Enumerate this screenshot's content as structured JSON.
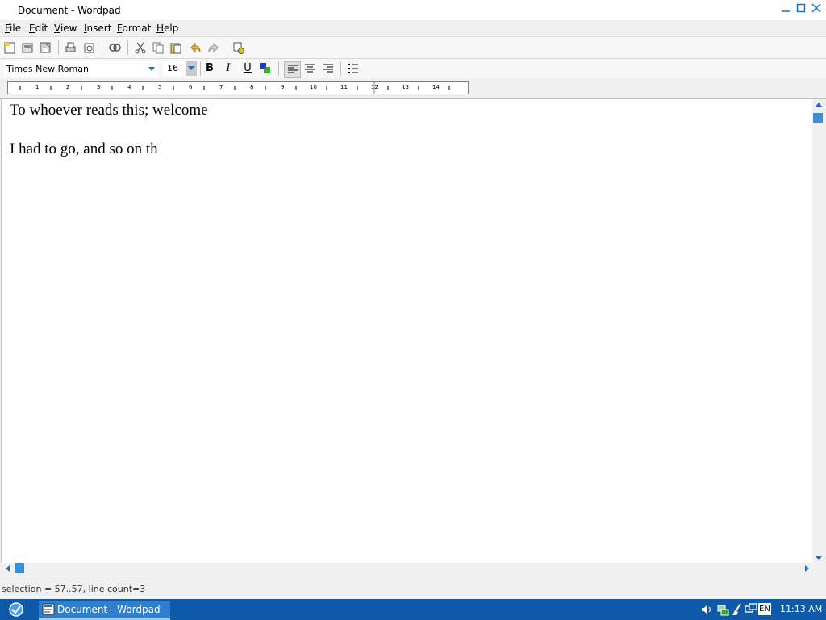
{
  "window": {
    "title": "Document - Wordpad"
  },
  "menu": {
    "file": "F",
    "file_rest": "ile",
    "edit": "E",
    "edit_rest": "dit",
    "view": "V",
    "view_rest": "iew",
    "insert": "I",
    "insert_rest": "nsert",
    "format": "F",
    "format_rest": "ormat",
    "help": "H",
    "help_rest": "elp"
  },
  "toolbar": {
    "icons": [
      "new-document-icon",
      "open-icon",
      "save-icon",
      "print-icon",
      "print-preview-icon",
      "find-icon",
      "cut-icon",
      "copy-icon",
      "paste-icon",
      "undo-icon",
      "redo-icon",
      "insert-datetime-icon"
    ]
  },
  "format_bar": {
    "font": "Times New Roman",
    "size": "16",
    "bold": "B",
    "italic": "I",
    "underline": "U"
  },
  "ruler": {
    "ticks": [
      "1",
      "2",
      "3",
      "4",
      "5",
      "6",
      "7",
      "8",
      "9",
      "10",
      "11",
      "12",
      "13",
      "14"
    ]
  },
  "document": {
    "lines": [
      "To whoever reads this; welcome",
      "I had to go, and so on th"
    ]
  },
  "status": {
    "text": "selection = 57..57, line count=3"
  },
  "taskbar": {
    "task_label": "Document - Wordpad",
    "lang": "EN",
    "clock": "11:13 AM"
  },
  "colors": {
    "accent": "#1c6fc8",
    "taskbar": "#0e5aa8",
    "thumb": "#3b8fd9"
  }
}
